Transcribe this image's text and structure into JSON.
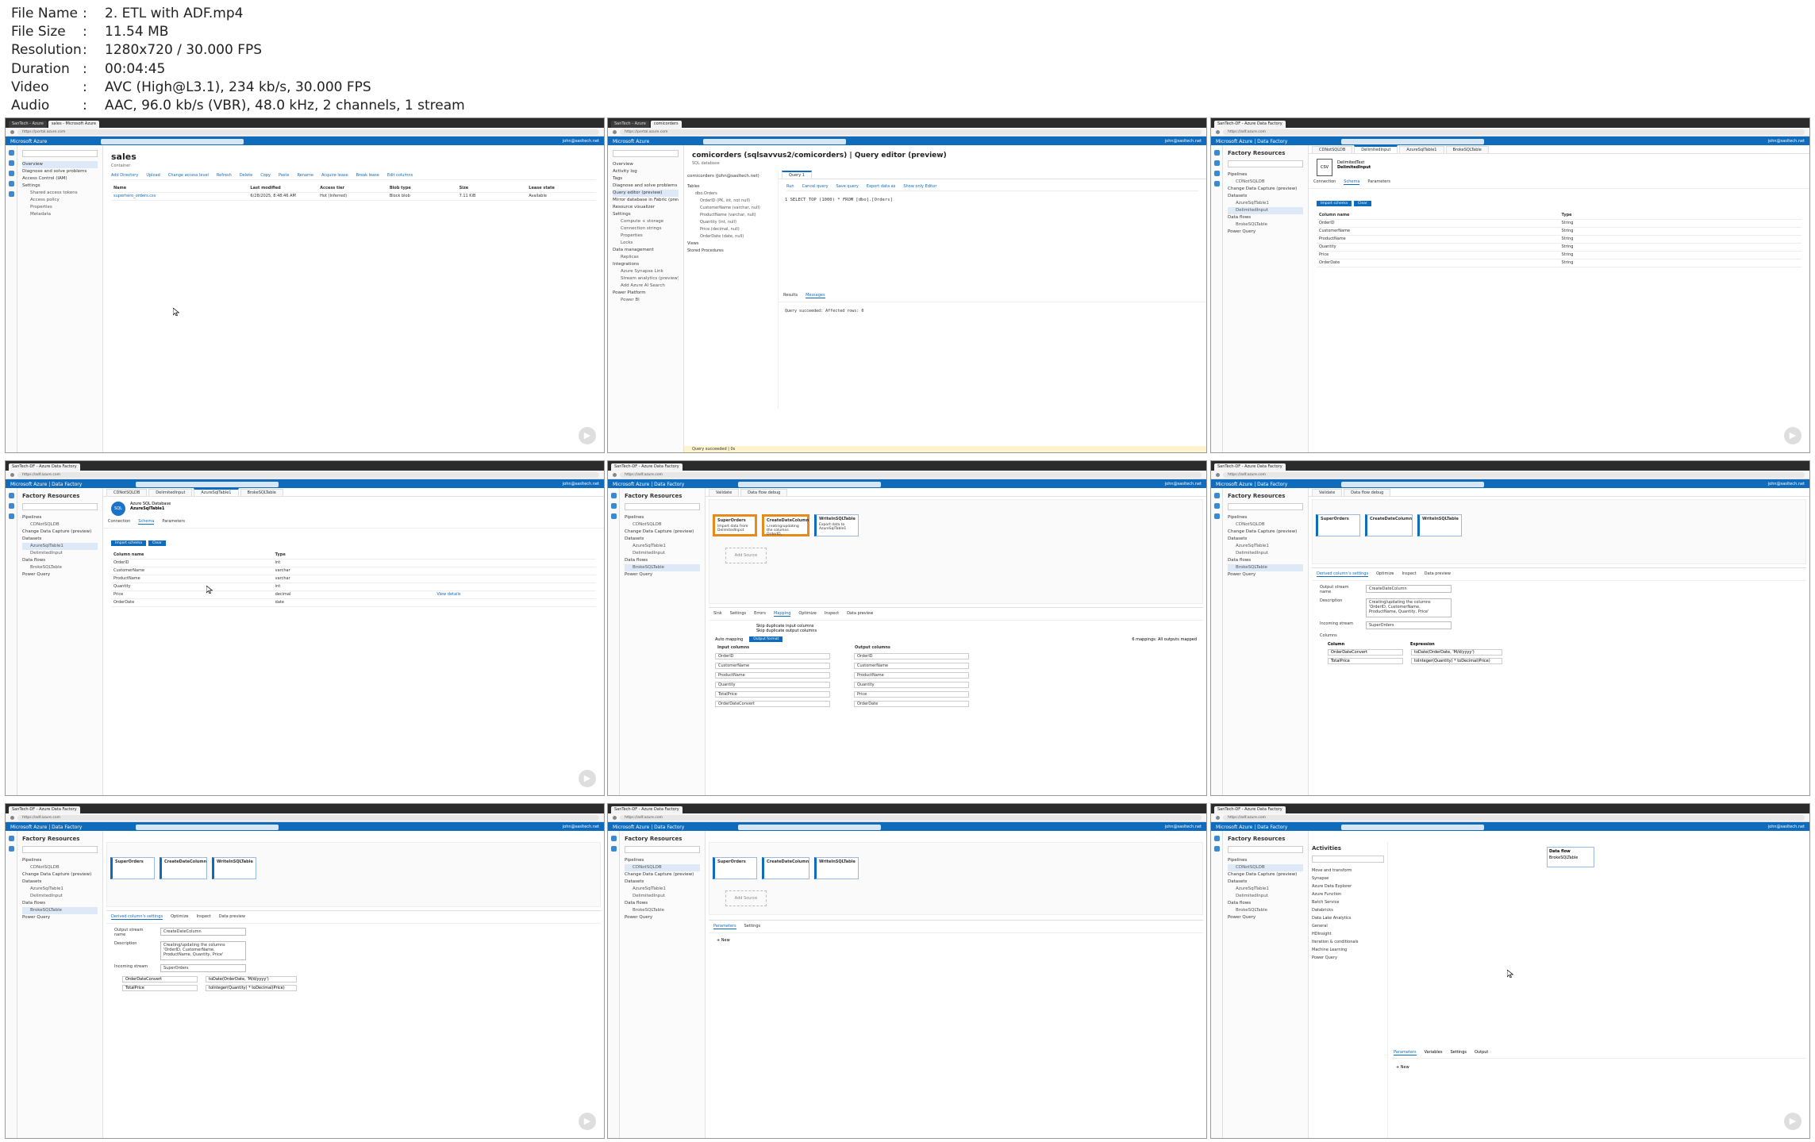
{
  "info": {
    "rows": [
      {
        "key": "File Name",
        "sep": ":",
        "value": "2. ETL with ADF.mp4"
      },
      {
        "key": "File Size",
        "sep": ":",
        "value": "11.54 MB"
      },
      {
        "key": "Resolution",
        "sep": ":",
        "value": "1280x720 / 30.000 FPS"
      },
      {
        "key": "Duration",
        "sep": ":",
        "value": "00:04:45"
      },
      {
        "key": "Video",
        "sep": ":",
        "value": "AVC (High@L3.1), 234 kb/s, 30.000 FPS"
      },
      {
        "key": "Audio",
        "sep": ":",
        "value": "AAC, 96.0 kb/s (VBR), 48.0 kHz, 2 channels, 1 stream"
      }
    ]
  },
  "common": {
    "portal": "Microsoft Azure",
    "adf": "Microsoft Azure | Data Factory",
    "user": "john@sasltech.net",
    "factory_resources": "Factory Resources",
    "side_items": [
      {
        "label": "Pipelines",
        "sub": false
      },
      {
        "label": "CDNotSQLDB",
        "sub": true
      },
      {
        "label": "Change Data Capture (preview)",
        "sub": false
      },
      {
        "label": "Datasets",
        "sub": false
      },
      {
        "label": "AzureSqlTable1",
        "sub": true
      },
      {
        "label": "DelimitedInput",
        "sub": true
      },
      {
        "label": "Data flows",
        "sub": false
      },
      {
        "label": "BrokeSQLTable",
        "sub": true
      },
      {
        "label": "Power Query",
        "sub": false
      }
    ]
  },
  "frame1": {
    "tab": "sales - Microsoft Azure",
    "title": "sales",
    "subtitle": "Container",
    "toolbar": [
      "Add Directory",
      "Upload",
      "Change access level",
      "Refresh",
      "Delete",
      "Copy",
      "Paste",
      "Rename",
      "Acquire lease",
      "Break lease",
      "Edit columns"
    ],
    "side": [
      "Overview",
      "Diagnose and solve problems",
      "Access Control (IAM)",
      "Settings",
      "Shared access tokens",
      "Access policy",
      "Properties",
      "Metadata"
    ],
    "headers": [
      "Name",
      "Last modified",
      "Access tier",
      "Blob type",
      "Size",
      "Lease state"
    ],
    "row": [
      "superhero_orders.csv",
      "6/28/2025, 8:48:46 AM",
      "Hot (Inferred)",
      "Block blob",
      "7.11 KiB",
      "Available"
    ]
  },
  "frame2": {
    "title": "comicorders (sqlsavvus2/comicorders) | Query editor (preview)",
    "subtitle": "SQL database",
    "toolbar": [
      "Run",
      "Cancel query",
      "Save query",
      "Export data as",
      "Show only Editor"
    ],
    "side": [
      "Overview",
      "Activity log",
      "Tags",
      "Diagnose and solve problems",
      "Query editor (preview)",
      "Mirror database in Fabric (preview)",
      "Resource visualizer",
      "Settings",
      "Compute + storage",
      "Connection strings",
      "Properties",
      "Locks",
      "Data management",
      "Replicas",
      "Integrations",
      "Azure Synapse Link",
      "Stream analytics (preview)",
      "Add Azure AI Search",
      "Power Platform",
      "Power BI"
    ],
    "user": "comicorders (John@sasltech.net)",
    "query_tab": "Query 1",
    "query": "1   SELECT TOP (1000) * FROM [dbo].[Orders]",
    "tables": [
      "Tables",
      "dbo.Orders",
      "OrderID (PK, int, not null)",
      "CustomerName (varchar, null)",
      "ProductName (varchar, null)",
      "Quantity (int, null)",
      "Price (decimal, null)",
      "OrderDate (date, null)",
      "Views",
      "Stored Procedures"
    ],
    "result_tabs": [
      "Results",
      "Messages"
    ],
    "message": "Query succeeded: Affected rows: 0",
    "status": "Query succeeded | 0s"
  },
  "frame3": {
    "tabs": [
      "CDNotSQLDB",
      "DelimitedInput",
      "AzureSqlTable1",
      "BrokeSQLTable"
    ],
    "dataset_type": "DelimitedText",
    "dataset_name": "DelimitedInput",
    "sub_tabs": [
      "Connection",
      "Schema",
      "Parameters"
    ],
    "buttons": [
      "Import schema",
      "Clear"
    ],
    "headers": [
      "Column name",
      "Type"
    ],
    "rows": [
      [
        "OrderID",
        "String"
      ],
      [
        "CustomerName",
        "String"
      ],
      [
        "ProductName",
        "String"
      ],
      [
        "Quantity",
        "String"
      ],
      [
        "Price",
        "String"
      ],
      [
        "OrderDate",
        "String"
      ]
    ]
  },
  "frame4": {
    "dataset_type": "Azure SQL Database",
    "dataset_name": "AzureSqlTable1",
    "headers": [
      "Column name",
      "Type"
    ],
    "rows": [
      [
        "OrderID",
        "int"
      ],
      [
        "CustomerName",
        "varchar"
      ],
      [
        "ProductName",
        "varchar"
      ],
      [
        "Quantity",
        "int"
      ],
      [
        "Price",
        "decimal"
      ],
      [
        "OrderDate",
        "date"
      ]
    ],
    "view_details": "View details"
  },
  "frame5": {
    "toolbar": [
      "Validate",
      "Data flow debug"
    ],
    "nodes": [
      {
        "title": "SuperOrders",
        "desc": "Import data from DelimitedInput"
      },
      {
        "title": "CreateDateColumn",
        "desc": "Creating/updating the columns OrderID, CustomerName, ProductName, Quantity, Price"
      },
      {
        "title": "WriteInSQLTable",
        "desc": "Export data to AzureSqlTable1"
      }
    ],
    "add_source": "Add Source",
    "lower_tabs": [
      "Sink",
      "Settings",
      "Errors",
      "Mapping",
      "Optimize",
      "Inspect",
      "Data preview"
    ],
    "options": [
      "Skip duplicate input columns",
      "Skip duplicate output columns"
    ],
    "auto_mapping": "Auto mapping",
    "output_format": "Output format",
    "mapped": "6 mappings: All outputs mapped",
    "map_headers": [
      "Input columns",
      "Output columns"
    ],
    "maps": [
      [
        "OrderID",
        "OrderID"
      ],
      [
        "CustomerName",
        "CustomerName"
      ],
      [
        "ProductName",
        "ProductName"
      ],
      [
        "Quantity",
        "Quantity"
      ],
      [
        "TotalPrice",
        "Price"
      ],
      [
        "OrderDateConvert",
        "OrderDate"
      ]
    ]
  },
  "frame6": {
    "lower_tabs": [
      "Derived column's settings",
      "Optimize",
      "Inspect",
      "Data preview"
    ],
    "labels": [
      "Output stream name",
      "Description",
      "Incoming stream",
      "Columns"
    ],
    "values": [
      "CreateDateColumn",
      "Creating/updating the columns 'OrderID, CustomerName, ProductName, Quantity, Price'",
      "SuperOrders"
    ],
    "col_headers": [
      "Column",
      "Expression"
    ],
    "exprs": [
      [
        "OrderDateConvert",
        "toDate(OrderDate, 'M/d/yyyy')"
      ],
      [
        "TotalPrice",
        "toInteger(Quantity) * toDecimal(Price)"
      ]
    ]
  },
  "frame8": {
    "lower_tabs": [
      "Parameters",
      "Settings"
    ],
    "new": "New"
  },
  "frame9": {
    "activities_title": "Activities",
    "activities": [
      "Move and transform",
      "Synapse",
      "Azure Data Explorer",
      "Azure Function",
      "Batch Service",
      "Databricks",
      "Data Lake Analytics",
      "General",
      "HDInsight",
      "Iteration & conditionals",
      "Machine Learning",
      "Power Query"
    ],
    "node_title": "Data flow",
    "node_name": "BrokeSQLTable",
    "lower_tabs": [
      "Parameters",
      "Variables",
      "Settings",
      "Output"
    ],
    "new": "New"
  }
}
